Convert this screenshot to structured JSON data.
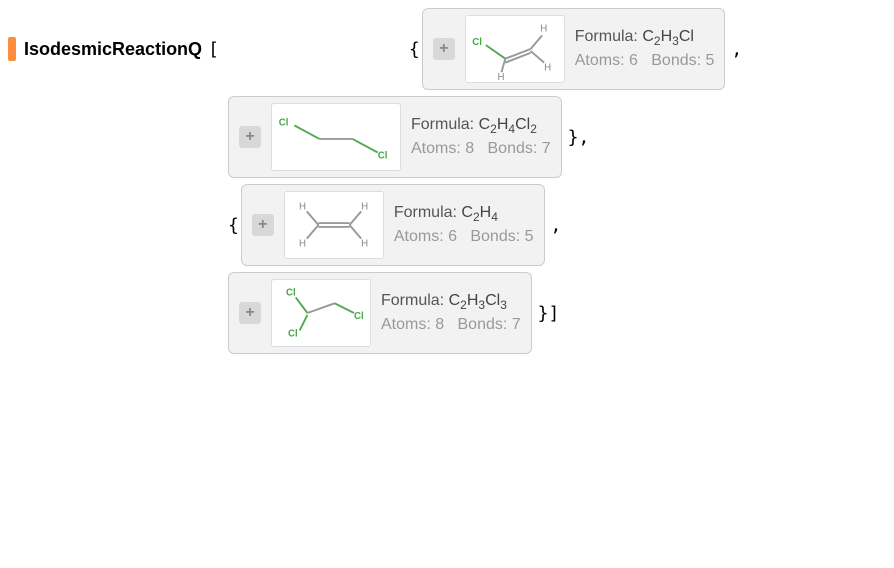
{
  "function_name": "IsodesmicReactionQ",
  "molecules": [
    {
      "formula_plain": "C2H3Cl",
      "formula_html": "C<sub>2</sub>H<sub>3</sub>Cl",
      "atoms": 6,
      "bonds": 5
    },
    {
      "formula_plain": "C2H4Cl2",
      "formula_html": "C<sub>2</sub>H<sub>4</sub>Cl<sub>2</sub>",
      "atoms": 8,
      "bonds": 7
    },
    {
      "formula_plain": "C2H4",
      "formula_html": "C<sub>2</sub>H<sub>4</sub>",
      "atoms": 6,
      "bonds": 5
    },
    {
      "formula_plain": "C2H3Cl3",
      "formula_html": "C<sub>2</sub>H<sub>3</sub>Cl<sub>3</sub>",
      "atoms": 8,
      "bonds": 7
    }
  ],
  "labels": {
    "formula": "Formula:",
    "atoms": "Atoms:",
    "bonds": "Bonds:"
  }
}
